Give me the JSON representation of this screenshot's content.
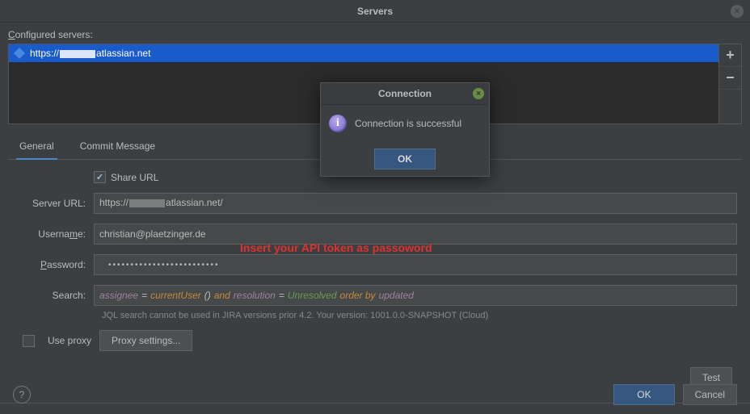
{
  "window": {
    "title": "Servers",
    "close_glyph": "×"
  },
  "configured_label_pre": "C",
  "configured_label_post": "onfigured servers:",
  "server_list": {
    "items": [
      {
        "url_prefix": "https://",
        "url_suffix": "atlassian.net"
      }
    ],
    "add_glyph": "+",
    "remove_glyph": "−"
  },
  "tabs": {
    "general": "General",
    "commit": "Commit Message"
  },
  "form": {
    "share_url_label": "Share URL",
    "share_url_underline": "S",
    "server_url_label": "Server URL:",
    "server_url_prefix": "https://",
    "server_url_suffix": "atlassian.net/",
    "username_label_pre": "Userna",
    "username_label_u": "m",
    "username_label_post": "e:",
    "username_value": "christian@plaetzinger.de",
    "password_label_u": "P",
    "password_label_post": "assword:",
    "password_dots": "•••••••••••••••••••••••••",
    "search_label": "Search:",
    "search_tokens": {
      "t1": "assignee",
      "t2": "=",
      "t3": "currentUser",
      "t4": "()",
      "t5": "and",
      "t6": "resolution",
      "t7": "=",
      "t8": "Unresolved",
      "t9": "order by",
      "t10": "updated"
    },
    "jql_help": "JQL search cannot be used in JIRA versions prior 4.2. Your version: 1001.0.0-SNAPSHOT (Cloud)",
    "use_proxy_label": "Use proxy",
    "proxy_settings_label": "Proxy settings...",
    "test_label_u": "T",
    "test_label_post": "est"
  },
  "footer": {
    "help_glyph": "?",
    "ok_label": "OK",
    "cancel_label": "Cancel"
  },
  "dialog": {
    "title": "Connection",
    "close_glyph": "×",
    "info_glyph": "i",
    "message": "Connection is successful",
    "ok_label": "OK"
  },
  "annotation": "Insert your API token as passoword"
}
